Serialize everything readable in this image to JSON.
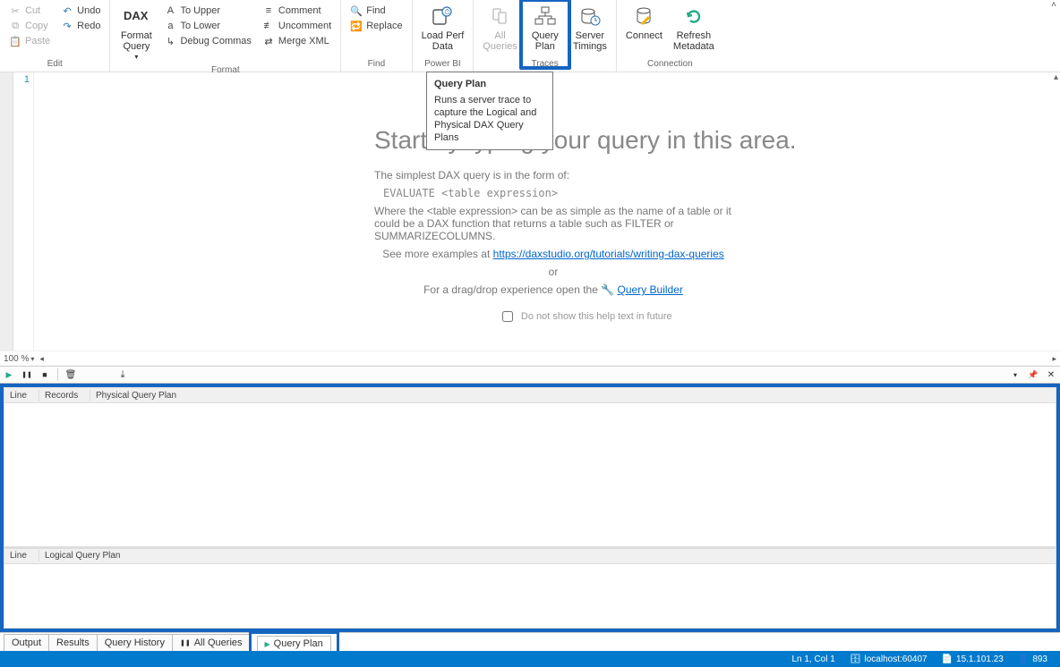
{
  "ribbon": {
    "collapse_icon": "˄",
    "groups": {
      "edit": {
        "label": "Edit",
        "cut": "Cut",
        "copy": "Copy",
        "paste": "Paste",
        "undo": "Undo",
        "redo": "Redo"
      },
      "format": {
        "label": "Format",
        "big_button": "Format\nQuery",
        "to_upper": "To Upper",
        "to_lower": "To Lower",
        "debug_commas": "Debug Commas",
        "comment": "Comment",
        "uncomment": "Uncomment",
        "merge_xml": "Merge XML"
      },
      "find": {
        "label": "Find",
        "find": "Find",
        "replace": "Replace"
      },
      "powerbi": {
        "label": "Power BI",
        "load_perf": "Load Perf\nData"
      },
      "traces": {
        "label": "Traces",
        "all_queries": "All\nQueries",
        "query_plan": "Query\nPlan",
        "server_timings": "Server\nTimings"
      },
      "connection": {
        "label": "Connection",
        "connect": "Connect",
        "refresh": "Refresh\nMetadata"
      }
    }
  },
  "tooltip": {
    "title": "Query Plan",
    "body": "Runs a server trace to capture the Logical and Physical DAX Query Plans"
  },
  "editor": {
    "line1": "1",
    "zoom": "100 %",
    "title": "Start by typing your query in this area.",
    "p1": "The simplest DAX query is in the form of:",
    "code": "EVALUATE <table expression>",
    "p2": "Where the <table expression> can be as simple as the name of a table or it could be a DAX function that returns a table such as FILTER or SUMMARIZECOLUMNS.",
    "examples_pre": "See more examples at ",
    "examples_link": "https://daxstudio.org/tutorials/writing-dax-queries",
    "or": "or",
    "drag_pre": "For a drag/drop experience open the ",
    "drag_link": "Query Builder",
    "checkbox_label": "Do not show this help text in future",
    "scroller_top": "▴",
    "scroller_down": "▾"
  },
  "trace_toolbar": {
    "play": "▶",
    "pause": "❚❚",
    "stop": "■",
    "clear": "🗑",
    "export": "⤓",
    "dropdown": "▾",
    "pin": "📌",
    "close": "✕"
  },
  "grid": {
    "physical": {
      "c1": "Line",
      "c2": "Records",
      "c3": "Physical Query Plan"
    },
    "logical": {
      "c1": "Line",
      "c2": "Logical Query Plan"
    }
  },
  "bottom_tabs": {
    "output": "Output",
    "results": "Results",
    "history": "Query History",
    "all_queries": "All Queries",
    "query_plan": "Query Plan",
    "pause_icon": "❚❚",
    "play_icon": "▶"
  },
  "status": {
    "lncol": "Ln 1, Col 1",
    "server": "localhost:60407",
    "version": "15.1.101.23",
    "spid": "893",
    "db_icon": "🗄",
    "doc_icon": "📄",
    "user_icon": "👤"
  }
}
